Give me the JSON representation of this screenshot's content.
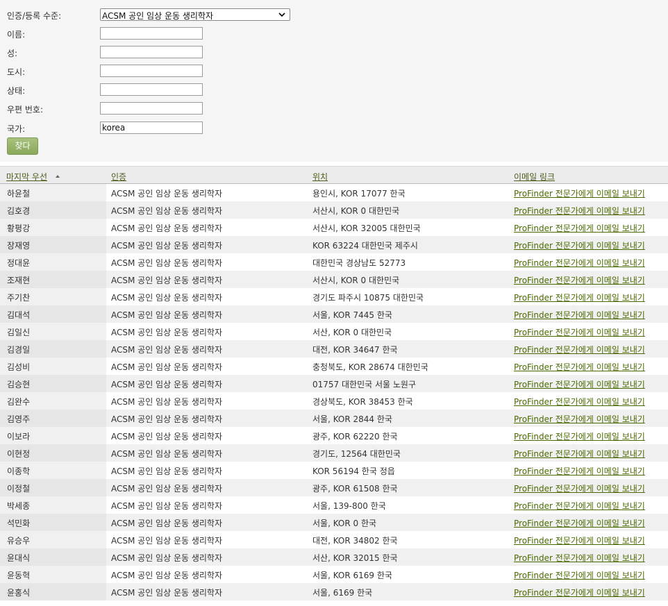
{
  "form": {
    "fields": [
      {
        "label": "인증/등록 수준:",
        "type": "select",
        "value": "ACSM 공인 임상 운동 생리학자"
      },
      {
        "label": "이름:",
        "type": "text",
        "value": ""
      },
      {
        "label": "성:",
        "type": "text",
        "value": ""
      },
      {
        "label": "도시:",
        "type": "text",
        "value": ""
      },
      {
        "label": "상태:",
        "type": "text",
        "value": ""
      },
      {
        "label": "우편 번호:",
        "type": "text",
        "value": ""
      },
      {
        "label": "국가:",
        "type": "text",
        "value": "korea"
      }
    ],
    "button_label": "찾다"
  },
  "table": {
    "columns": [
      "마지막 우선",
      "인증",
      "위치",
      "이메일 링크"
    ],
    "sorted_column": "마지막 우선",
    "sort_direction": "ascending",
    "rows": [
      {
        "name": "하윤철",
        "cert": "ACSM 공인 임상 운동 생리학자",
        "location": "용인시, KOR 17077 한국",
        "email": "ProFinder 전문가에게 이메일 보내기"
      },
      {
        "name": "김호경",
        "cert": "ACSM 공인 임상 운동 생리학자",
        "location": "서산시, KOR 0 대한민국",
        "email": "ProFinder 전문가에게 이메일 보내기"
      },
      {
        "name": "황평강",
        "cert": "ACSM 공인 임상 운동 생리학자",
        "location": "서산시, KOR 32005 대한민국",
        "email": "ProFinder 전문가에게 이메일 보내기"
      },
      {
        "name": "장재영",
        "cert": "ACSM 공인 임상 운동 생리학자",
        "location": "KOR 63224 대한민국 제주시",
        "email": "ProFinder 전문가에게 이메일 보내기"
      },
      {
        "name": "정대윤",
        "cert": "ACSM 공인 임상 운동 생리학자",
        "location": "대한민국 경상남도 52773",
        "email": "ProFinder 전문가에게 이메일 보내기"
      },
      {
        "name": "조재현",
        "cert": "ACSM 공인 임상 운동 생리학자",
        "location": "서산시, KOR 0 대한민국",
        "email": "ProFinder 전문가에게 이메일 보내기"
      },
      {
        "name": "주기찬",
        "cert": "ACSM 공인 임상 운동 생리학자",
        "location": "경기도 파주시 10875 대한민국",
        "email": "ProFinder 전문가에게 이메일 보내기"
      },
      {
        "name": "김대석",
        "cert": "ACSM 공인 임상 운동 생리학자",
        "location": "서울, KOR 7445 한국",
        "email": "ProFinder 전문가에게 이메일 보내기"
      },
      {
        "name": "김일신",
        "cert": "ACSM 공인 임상 운동 생리학자",
        "location": "서산, KOR 0 대한민국",
        "email": "ProFinder 전문가에게 이메일 보내기"
      },
      {
        "name": "김경일",
        "cert": "ACSM 공인 임상 운동 생리학자",
        "location": "대전, KOR 34647 한국",
        "email": "ProFinder 전문가에게 이메일 보내기"
      },
      {
        "name": "김성비",
        "cert": "ACSM 공인 임상 운동 생리학자",
        "location": "충청북도, KOR 28674 대한민국",
        "email": "ProFinder 전문가에게 이메일 보내기"
      },
      {
        "name": "김승현",
        "cert": "ACSM 공인 임상 운동 생리학자",
        "location": "01757 대한민국 서울 노원구",
        "email": "ProFinder 전문가에게 이메일 보내기"
      },
      {
        "name": "김완수",
        "cert": "ACSM 공인 임상 운동 생리학자",
        "location": "경상북도, KOR 38453 한국",
        "email": "ProFinder 전문가에게 이메일 보내기"
      },
      {
        "name": "김영주",
        "cert": "ACSM 공인 임상 운동 생리학자",
        "location": "서울, KOR 2844 한국",
        "email": "ProFinder 전문가에게 이메일 보내기"
      },
      {
        "name": "이보라",
        "cert": "ACSM 공인 임상 운동 생리학자",
        "location": "광주, KOR 62220 한국",
        "email": "ProFinder 전문가에게 이메일 보내기"
      },
      {
        "name": "이현정",
        "cert": "ACSM 공인 임상 운동 생리학자",
        "location": "경기도, 12564 대한민국",
        "email": "ProFinder 전문가에게 이메일 보내기"
      },
      {
        "name": "이종학",
        "cert": "ACSM 공인 임상 운동 생리학자",
        "location": "KOR 56194 한국 정읍",
        "email": "ProFinder 전문가에게 이메일 보내기"
      },
      {
        "name": "이정철",
        "cert": "ACSM 공인 임상 운동 생리학자",
        "location": "광주, KOR 61508 한국",
        "email": "ProFinder 전문가에게 이메일 보내기"
      },
      {
        "name": "박세종",
        "cert": "ACSM 공인 임상 운동 생리학자",
        "location": "서울, 139-800 한국",
        "email": "ProFinder 전문가에게 이메일 보내기"
      },
      {
        "name": "석민화",
        "cert": "ACSM 공인 임상 운동 생리학자",
        "location": "서울, KOR 0 한국",
        "email": "ProFinder 전문가에게 이메일 보내기"
      },
      {
        "name": "유승우",
        "cert": "ACSM 공인 임상 운동 생리학자",
        "location": "대전, KOR 34802 한국",
        "email": "ProFinder 전문가에게 이메일 보내기"
      },
      {
        "name": "윤대식",
        "cert": "ACSM 공인 임상 운동 생리학자",
        "location": "서산, KOR 32015 한국",
        "email": "ProFinder 전문가에게 이메일 보내기"
      },
      {
        "name": "윤동혁",
        "cert": "ACSM 공인 임상 운동 생리학자",
        "location": "서울, KOR 6169 한국",
        "email": "ProFinder 전문가에게 이메일 보내기"
      },
      {
        "name": "윤홍식",
        "cert": "ACSM 공인 임상 운동 생리학자",
        "location": "서울, 6169 한국",
        "email": "ProFinder 전문가에게 이메일 보내기"
      }
    ]
  },
  "colors": {
    "link": "#4a6a00",
    "header_link": "#4a5e1a",
    "button": "#95b266",
    "panel_background": "#f5f5f5",
    "row_alt": "#f0f0f0"
  },
  "icons": {
    "select_arrow": "chevron-down-icon",
    "sort_indicator": "sort-ascending-icon"
  }
}
